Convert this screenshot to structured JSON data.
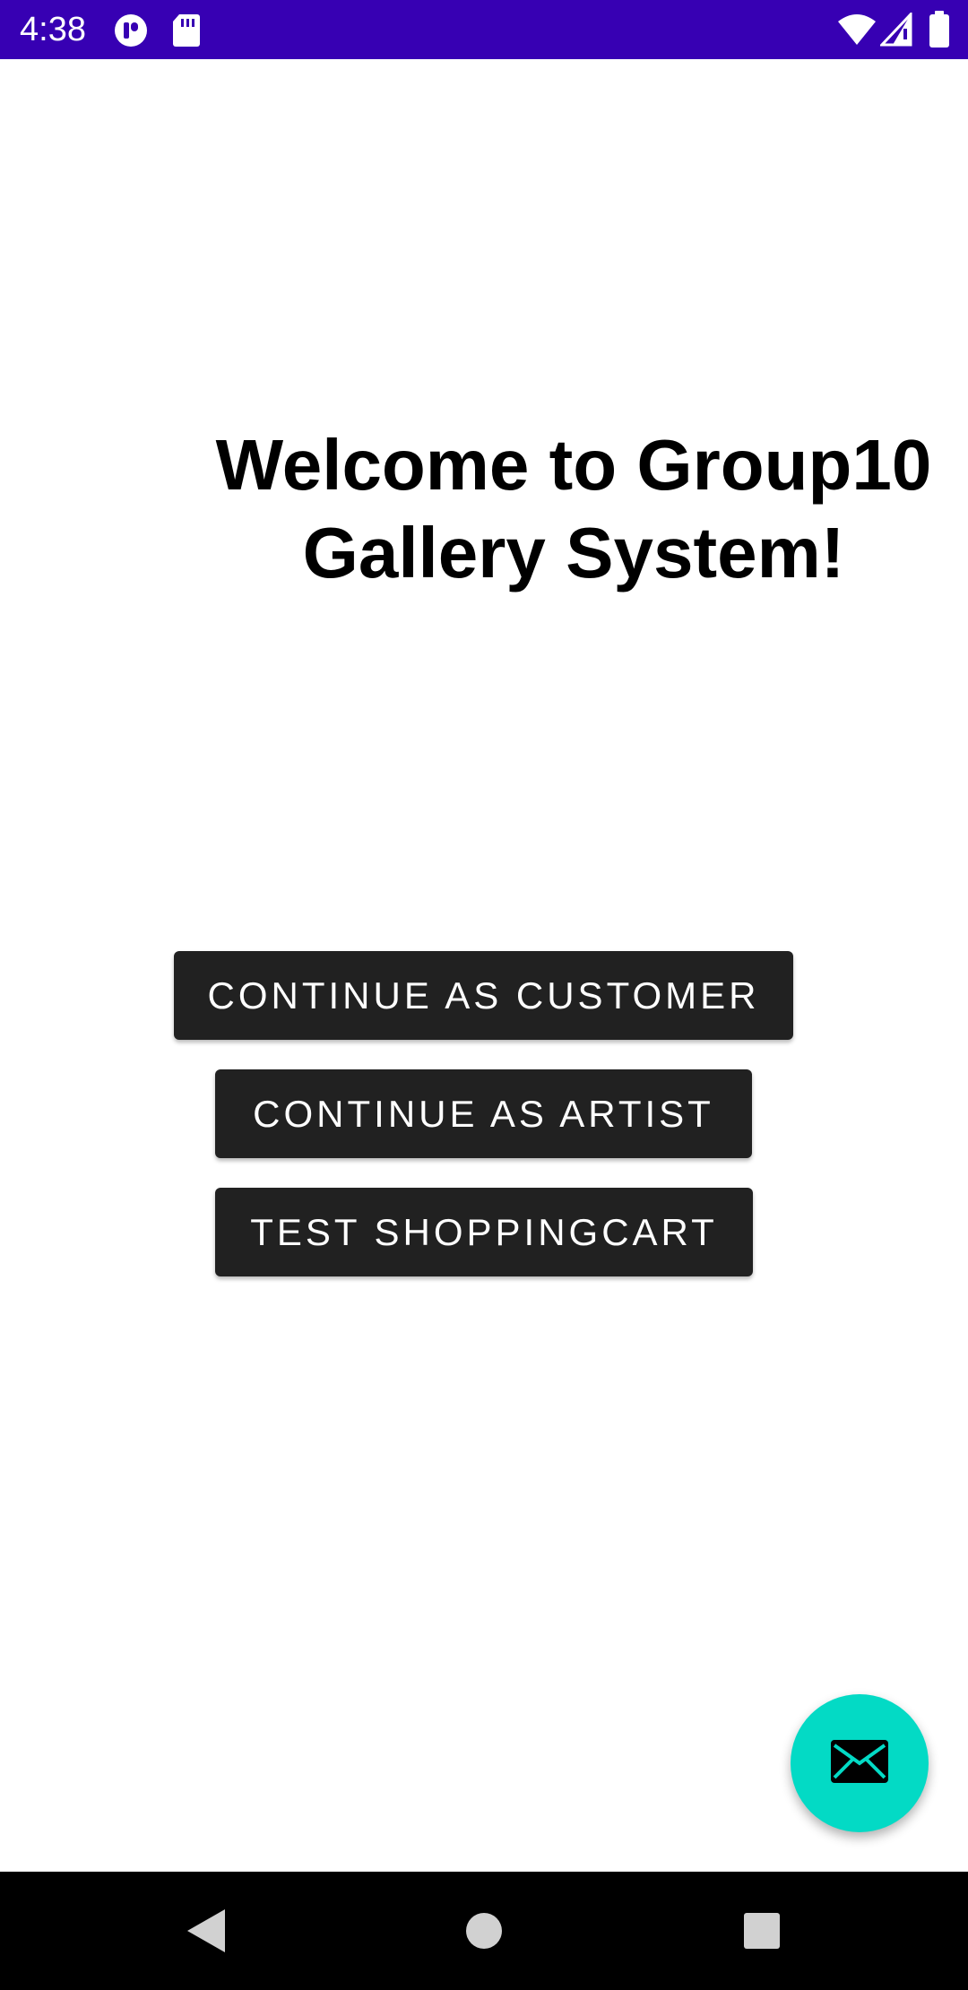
{
  "status_bar": {
    "time": "4:38",
    "background": "#3700b3",
    "icons_left": [
      "app-notification-icon",
      "sd-card-icon"
    ],
    "icons_right": [
      "wifi-icon",
      "cellular-signal-icon",
      "battery-icon"
    ]
  },
  "main": {
    "title": "Welcome to  Group10\nGallery System!",
    "buttons": {
      "customer": "CONTINUE AS CUSTOMER",
      "artist": "CONTINUE AS ARTIST",
      "shopping_cart": "TEST SHOPPINGCART"
    },
    "button_color": "#212121"
  },
  "fab": {
    "icon": "mail-icon",
    "color": "#03dac5"
  },
  "nav_bar": {
    "buttons": [
      "back-icon",
      "home-icon",
      "recents-icon"
    ]
  }
}
